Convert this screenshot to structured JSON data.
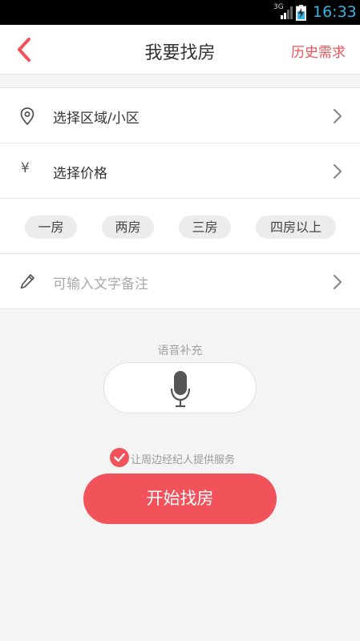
{
  "status_bar": {
    "network": "3G",
    "time": "16:33"
  },
  "nav": {
    "title": "我要找房",
    "history_label": "历史需求"
  },
  "form": {
    "area_label": "选择区域/小区",
    "price_label": "选择价格",
    "yen_symbol": "¥",
    "room_chips": [
      "一房",
      "两房",
      "三房",
      "四房以上"
    ],
    "note_placeholder": "可输入文字备注"
  },
  "voice": {
    "label": "语音补充"
  },
  "agree": {
    "text": "让周边经纪人提供服务",
    "checked": true
  },
  "start_button": {
    "label": "开始找房"
  },
  "colors": {
    "accent": "#f2525a",
    "status_time": "#34b5e5"
  }
}
